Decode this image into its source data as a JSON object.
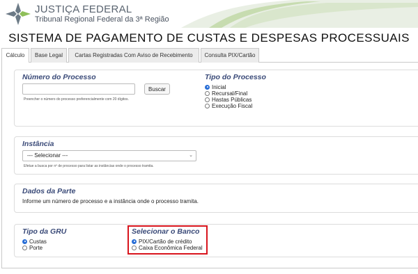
{
  "header": {
    "org_title": "JUSTIÇA FEDERAL",
    "org_subtitle": "Tribunal Regional Federal da 3ª Região",
    "system_title": "SISTEMA DE PAGAMENTO DE CUSTAS E DESPESAS PROCESSUAIS"
  },
  "tabs": [
    {
      "label": "Cálculo",
      "active": true
    },
    {
      "label": "Base Legal",
      "active": false
    },
    {
      "label": "Cartas Registradas Com Aviso de Recebimento (AR)",
      "active": false
    },
    {
      "label": "Consulta PIX/Cartão",
      "active": false
    }
  ],
  "processo": {
    "legend": "Número do Processo",
    "value": "",
    "search_label": "Buscar",
    "hint": "Preencher o número do processo preferencialmente com 20 dígitos."
  },
  "tipo_processo": {
    "legend": "Tipo do Processo",
    "options": [
      {
        "label": "Inicial",
        "checked": true
      },
      {
        "label": "Recursal/Final",
        "checked": false
      },
      {
        "label": "Hastas Públicas",
        "checked": false
      },
      {
        "label": "Execução Fiscal",
        "checked": false
      }
    ]
  },
  "instancia": {
    "legend": "Instância",
    "selected": "--- Selecionar ---",
    "hint": "Efetue a busca por nº de processo para listar as instâncias onde o processo tramita."
  },
  "dados_parte": {
    "legend": "Dados da Parte",
    "message": "Informe um número de processo e a instância onde o processo tramita."
  },
  "tipo_gru": {
    "legend": "Tipo da GRU",
    "options": [
      {
        "label": "Custas",
        "checked": true
      },
      {
        "label": "Porte",
        "checked": false
      }
    ]
  },
  "banco": {
    "legend": "Selecionar o Banco",
    "options": [
      {
        "label": "PIX/Cartão de crédito",
        "checked": true
      },
      {
        "label": "Caixa Econômica Federal",
        "checked": false
      }
    ],
    "highlight_color": "#d8141c"
  },
  "colors": {
    "legend": "#3a4a78",
    "accent_green": "#8fbf5a",
    "radio_selected": "#2a6fd6"
  }
}
